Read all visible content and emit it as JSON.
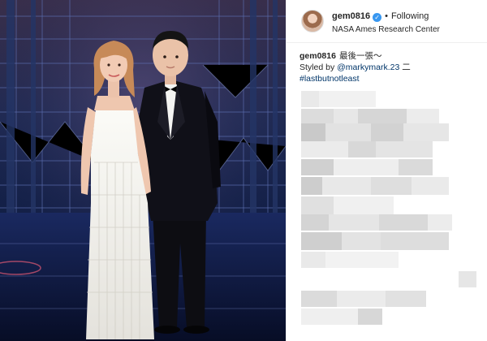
{
  "post": {
    "username": "gem0816",
    "verified_glyph": "✓",
    "separator": "•",
    "follow_status": "Following",
    "location": "NASA Ames Research Center"
  },
  "caption": {
    "username": "gem0816",
    "text": "最後一張～",
    "line2_prefix": "Styled by",
    "mention": "@markymark.23",
    "line2_suffix": "二",
    "hashtag": "#lastbutnotleast"
  },
  "photo": {
    "description_icon": "photo-image"
  },
  "colors": {
    "verified": "#3897f0",
    "link": "#003569",
    "text": "#262626"
  }
}
